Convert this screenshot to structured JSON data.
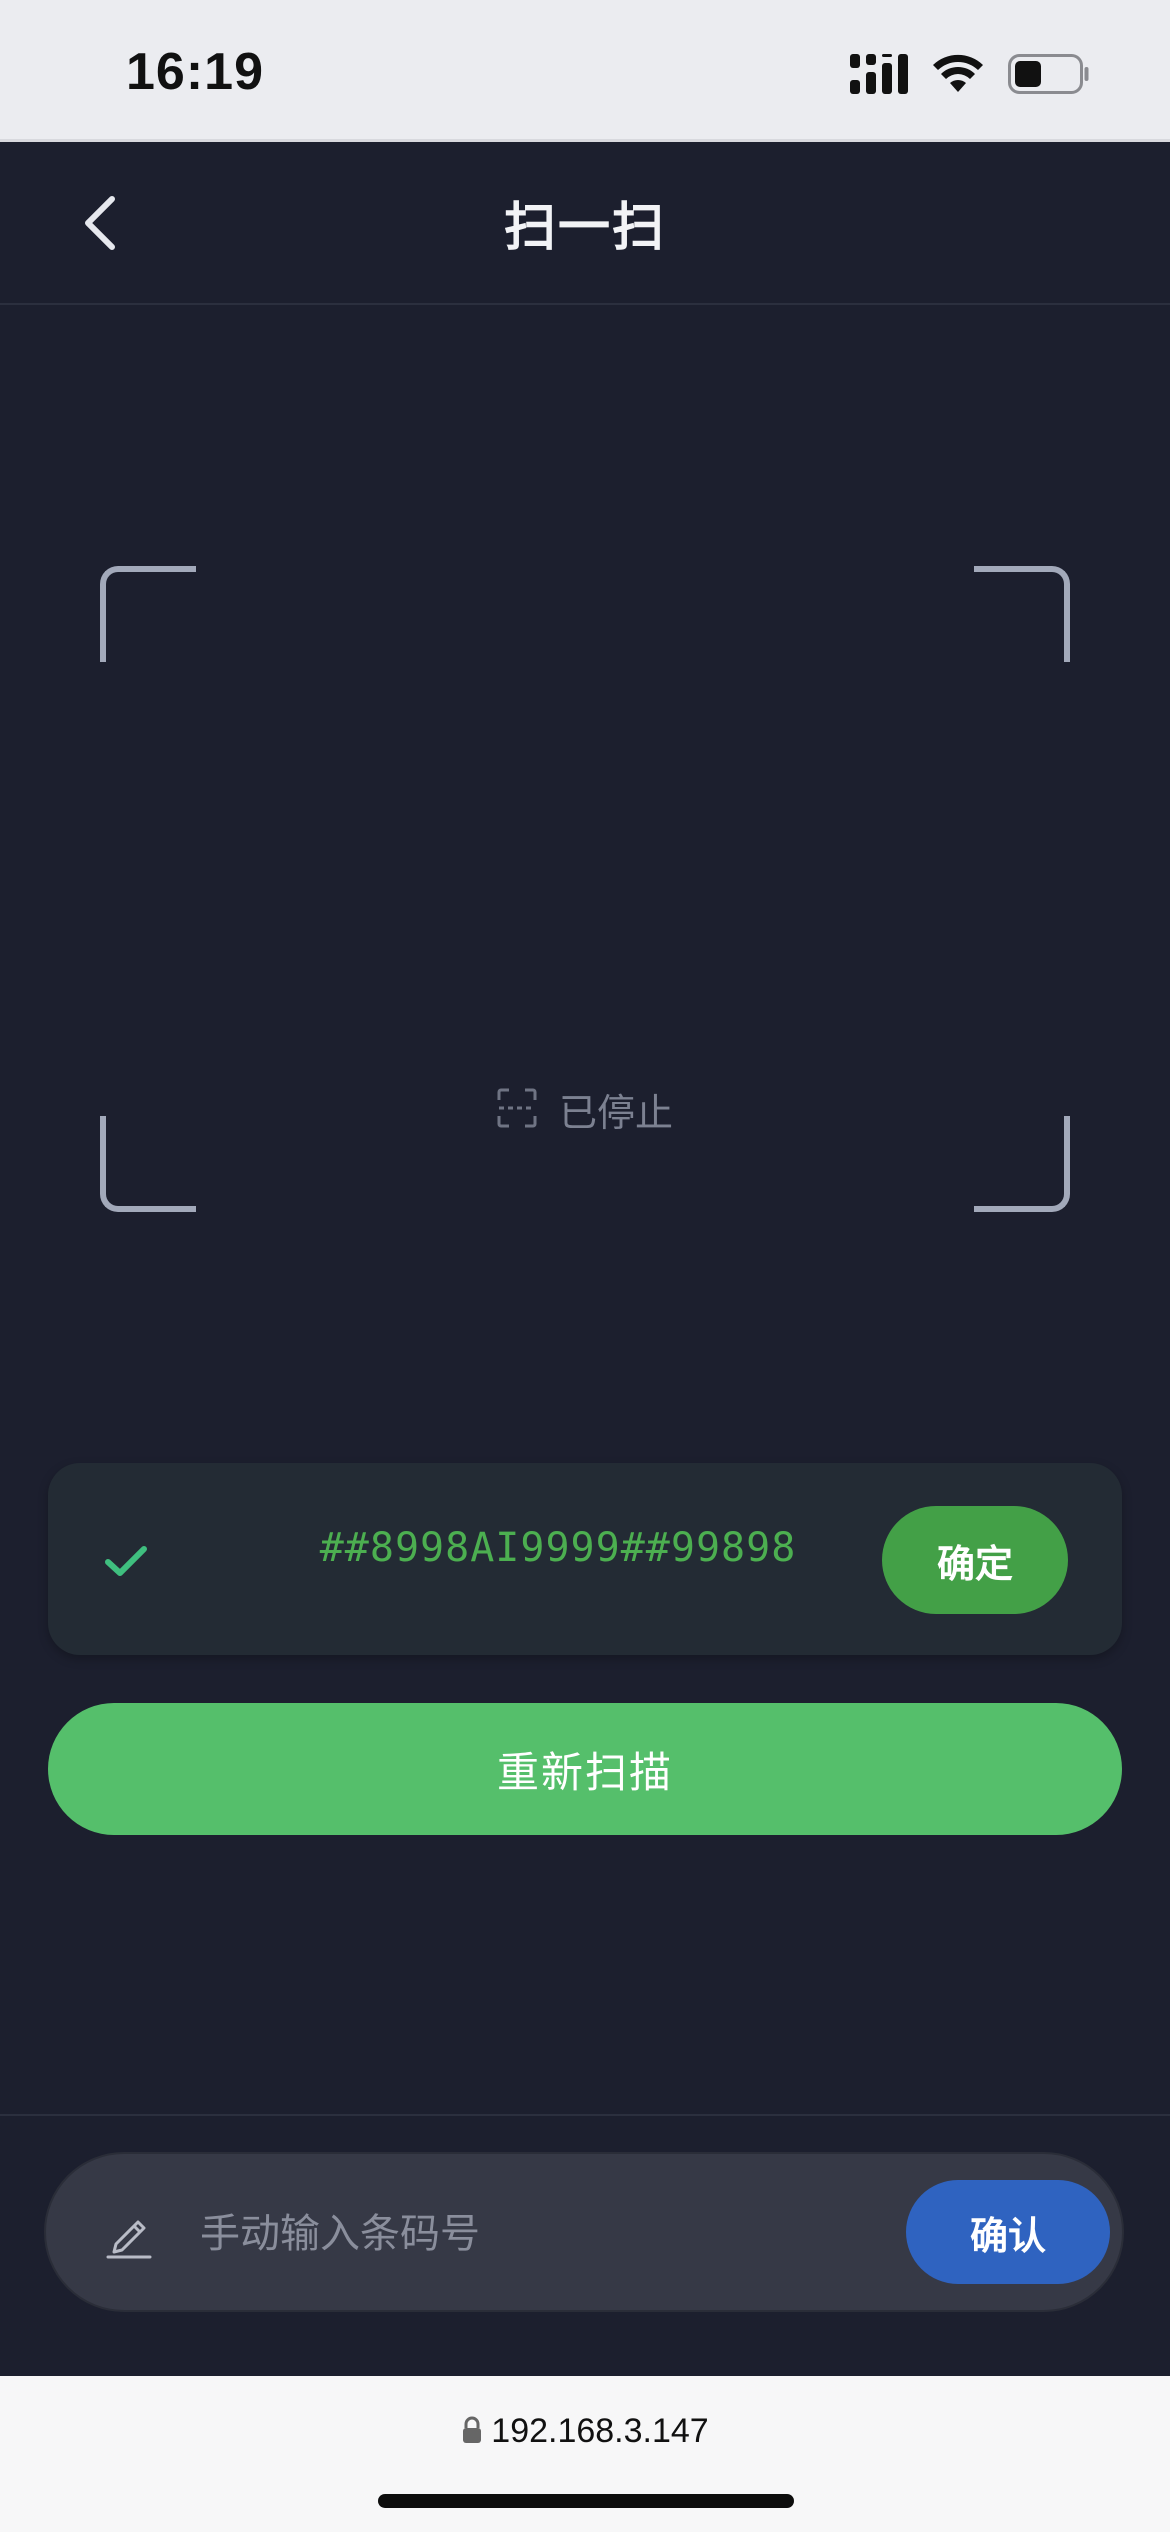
{
  "status_bar": {
    "time": "16:19",
    "icons": [
      "signal-icon",
      "wifi-icon",
      "battery-icon"
    ]
  },
  "nav": {
    "title": "扫一扫",
    "back_icon": "chevron-left-icon"
  },
  "scanner": {
    "status_text": "已停止",
    "status_icon": "scan-icon",
    "corner_color": "#a2a9ba"
  },
  "result": {
    "code": "##8998AI9999##99898",
    "confirm_label": "确定",
    "check_icon": "check-icon",
    "code_color": "#4caf50"
  },
  "rescan": {
    "label": "重新扫描",
    "color": "#55bf6b"
  },
  "manual_input": {
    "placeholder": "手动输入条码号",
    "value": "",
    "confirm_label": "确认",
    "icon": "pencil-icon",
    "confirm_color": "#2f63c0"
  },
  "browser": {
    "url": "192.168.3.147",
    "lock_icon": "lock-icon"
  },
  "colors": {
    "background": "#1c1f2e",
    "accent_green": "#55bf6b",
    "accent_blue": "#2f63c0"
  }
}
